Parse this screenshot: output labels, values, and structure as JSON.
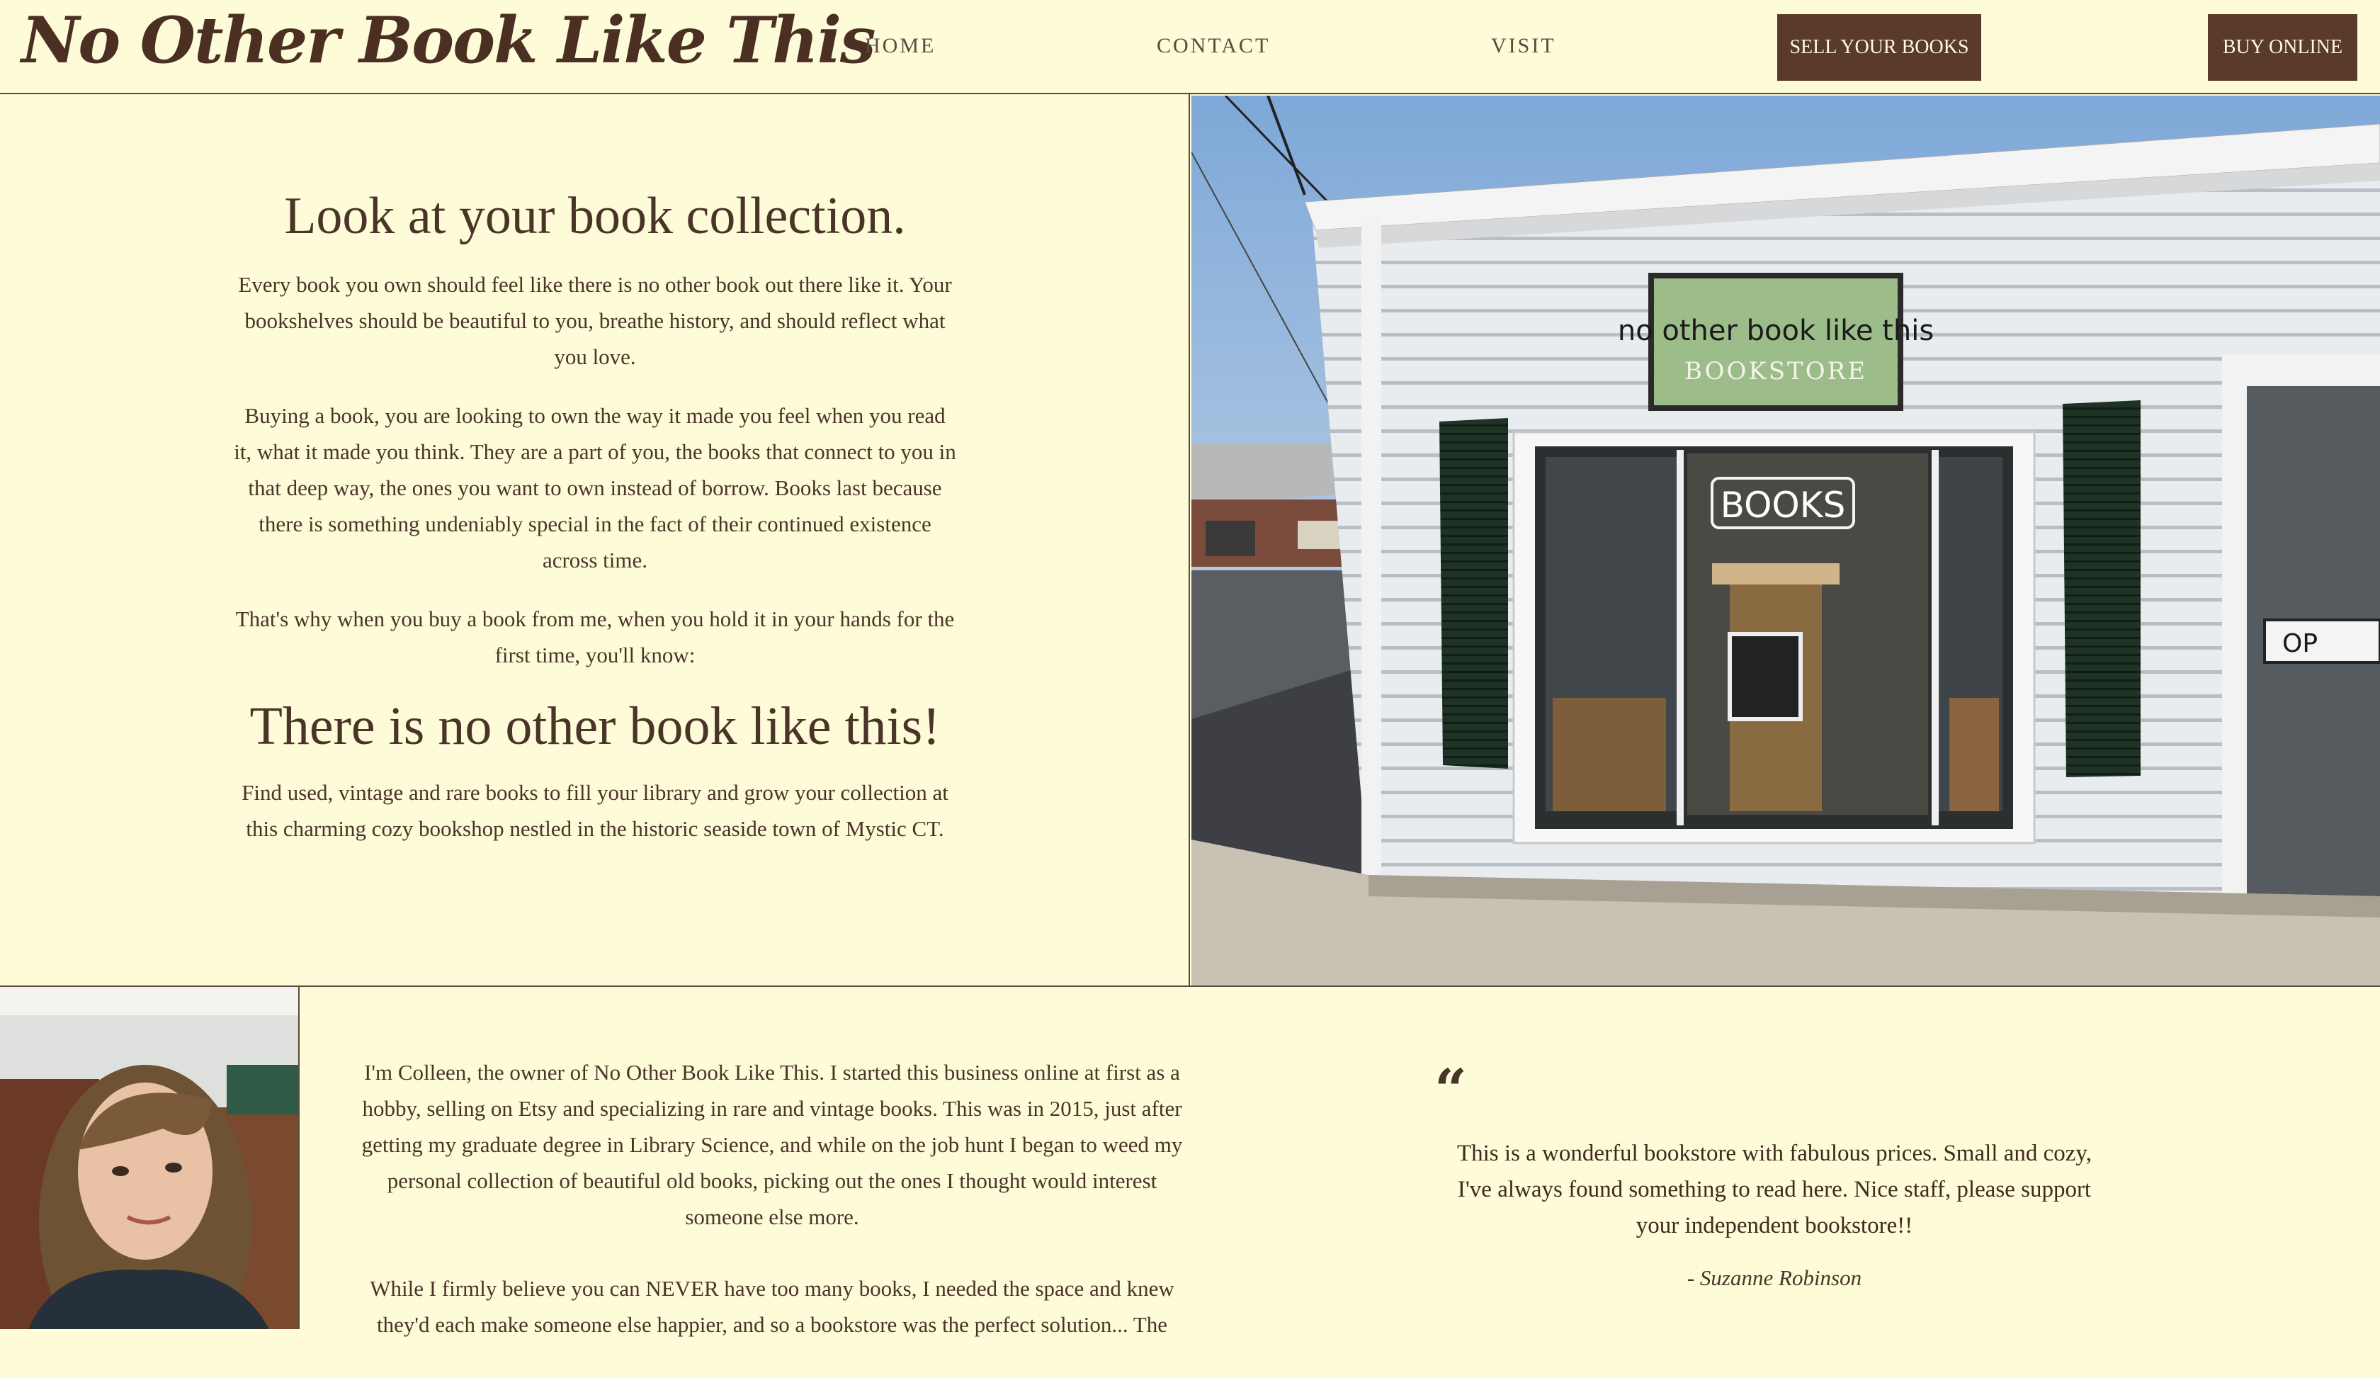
{
  "header": {
    "logo": "No Other Book Like This",
    "nav": [
      "HOME",
      "CONTACT",
      "VISIT"
    ],
    "sell_button": "SELL YOUR BOOKS",
    "buy_button": "BUY ONLINE"
  },
  "hero": {
    "title": "Look at your book collection.",
    "para1": "Every book you own should feel like there is no other book out there like it. Your bookshelves should be beautiful to you, breathe history, and should reflect what you love.",
    "para2": "Buying a book, you are looking to own the way it made you feel when you read it, what it made you think. They are a part of you, the books that connect to you in that deep way, the ones you want to own instead of borrow. Books last because there is something undeniably special in the fact of their continued existence across time.",
    "para3": "That's why when you buy a book from me, when you hold it in your hands for the first time, you'll know:",
    "subtitle": "There is no other book like this!",
    "para4": "Find used, vintage and rare books to fill your library and grow your collection at this charming cozy bookshop nestled in the historic seaside town of Mystic CT."
  },
  "storefront": {
    "sign_line1": "no other book like this",
    "sign_line2": "BOOKSTORE",
    "window_sign": "BOOKS",
    "side_sign": "OP"
  },
  "about": {
    "para1": "I'm Colleen, the owner of No Other Book Like This. I started this business online at first as a hobby, selling on Etsy and specializing in rare and vintage books. This was in 2015, just after getting my graduate degree in Library Science, and while on the job hunt I began to weed my personal collection of beautiful old books, picking out the ones I thought would interest someone else more.",
    "para2": "While I firmly believe you can NEVER have too many books, I needed the space and knew they'd each make someone else happier, and so a bookstore was the perfect solution... The"
  },
  "testimonial": {
    "mark": "“",
    "text": "This is a wonderful bookstore with fabulous prices. Small and cozy, I've always found something to read here. Nice staff, please support your independent bookstore!!",
    "author": "- Suzanne Robinson"
  }
}
